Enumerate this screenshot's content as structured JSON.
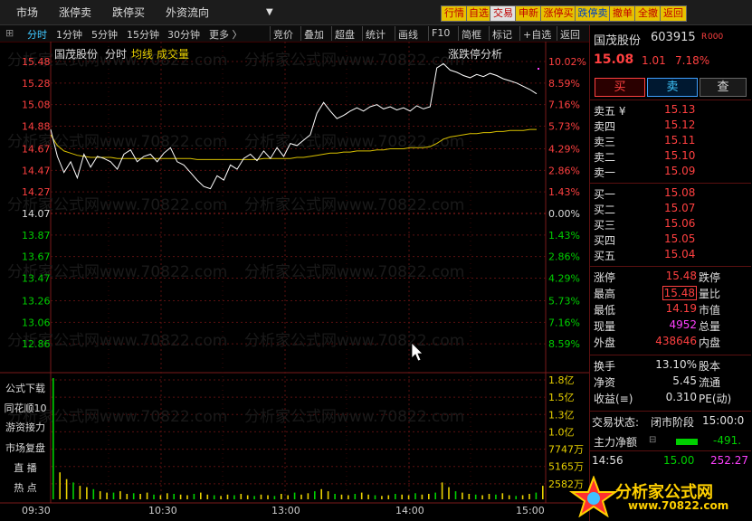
{
  "menubar": {
    "items": [
      "市场",
      "涨停卖",
      "跌停买",
      "外资流向"
    ],
    "buttons": [
      {
        "label": "行情",
        "color": "#e6c200",
        "text": "#c00000"
      },
      {
        "label": "自选",
        "color": "#e6c200",
        "text": "#c00000"
      },
      {
        "label": "交易",
        "color": "#e0e0e0",
        "text": "#c00000"
      },
      {
        "label": "申新",
        "color": "#e6c200",
        "text": "#c00000"
      },
      {
        "label": "涨停买",
        "color": "#e6c200",
        "text": "#c00000"
      },
      {
        "label": "跌停卖",
        "color": "#e6c200",
        "text": "#0040c0"
      },
      {
        "label": "撤单",
        "color": "#e6c200",
        "text": "#c00000"
      },
      {
        "label": "全撤",
        "color": "#e6c200",
        "text": "#c00000"
      },
      {
        "label": "返回",
        "color": "#e6c200",
        "text": "#c00000"
      }
    ]
  },
  "toolbar": {
    "tabs": [
      "分时",
      "1分钟",
      "5分钟",
      "15分钟",
      "30分钟",
      "更多 〉"
    ],
    "tools": [
      "竞价",
      "叠加",
      "超盘",
      "统计",
      "画线",
      "F10",
      "简框",
      "标记",
      "+自选",
      "返回"
    ]
  },
  "chart_header": {
    "stock_name": "国茂股份",
    "period": "分时",
    "avg_label": "均线",
    "vol_label": "成交量",
    "right_label": "涨跌停分析"
  },
  "price_axis": [
    "15.48",
    "15.28",
    "15.08",
    "14.88",
    "14.67",
    "14.47",
    "14.27",
    "14.07",
    "13.87",
    "13.67",
    "13.47",
    "13.26",
    "13.06",
    "12.86"
  ],
  "pct_axis": [
    "10.02%",
    "8.59%",
    "7.16%",
    "5.73%",
    "4.29%",
    "2.86%",
    "1.43%",
    "0.00%",
    "1.43%",
    "2.86%",
    "4.29%",
    "5.73%",
    "7.16%",
    "8.59%"
  ],
  "volume_axis": [
    "1.8亿",
    "1.5亿",
    "1.3亿",
    "1.0亿",
    "7747万",
    "5165万",
    "2582万"
  ],
  "time_axis": [
    "09:30",
    "10:30",
    "13:00",
    "14:00",
    "15:00"
  ],
  "side_buttons": [
    "公式下载",
    "同花顺10",
    "游资接力",
    "市场复盘",
    "直 播",
    "热 点"
  ],
  "watermark": "分析家公式网www.70822.com",
  "chart_data": {
    "type": "line",
    "prev_close": 14.07,
    "ylim": [
      12.66,
      15.48
    ],
    "x_range": [
      "09:30",
      "15:00"
    ],
    "series": [
      {
        "name": "价格",
        "values": [
          14.85,
          14.6,
          14.45,
          14.55,
          14.4,
          14.62,
          14.5,
          14.6,
          14.58,
          14.55,
          14.48,
          14.62,
          14.66,
          14.55,
          14.6,
          14.62,
          14.55,
          14.63,
          14.68,
          14.55,
          14.52,
          14.45,
          14.38,
          14.32,
          14.3,
          14.42,
          14.38,
          14.52,
          14.48,
          14.58,
          14.62,
          14.56,
          14.65,
          14.58,
          14.68,
          14.6,
          14.72,
          14.7,
          14.75,
          14.8,
          15.0,
          15.1,
          15.02,
          14.95,
          14.98,
          15.02,
          15.05,
          15.02,
          15.06,
          15.08,
          15.04,
          15.06,
          15.03,
          15.05,
          15.02,
          15.07,
          15.04,
          15.06,
          15.42,
          15.46,
          15.4,
          15.38,
          15.35,
          15.33,
          15.36,
          15.34,
          15.37,
          15.35,
          15.32,
          15.3,
          15.28,
          15.25,
          15.22,
          15.18
        ]
      },
      {
        "name": "均线",
        "values": [
          14.8,
          14.7,
          14.65,
          14.63,
          14.61,
          14.6,
          14.59,
          14.59,
          14.59,
          14.59,
          14.58,
          14.58,
          14.58,
          14.58,
          14.58,
          14.58,
          14.58,
          14.58,
          14.58,
          14.58,
          14.58,
          14.58,
          14.57,
          14.57,
          14.57,
          14.57,
          14.57,
          14.57,
          14.57,
          14.57,
          14.57,
          14.57,
          14.58,
          14.58,
          14.58,
          14.58,
          14.58,
          14.59,
          14.59,
          14.6,
          14.61,
          14.62,
          14.63,
          14.63,
          14.64,
          14.64,
          14.65,
          14.65,
          14.65,
          14.66,
          14.66,
          14.67,
          14.67,
          14.67,
          14.68,
          14.68,
          14.68,
          14.69,
          14.72,
          14.76,
          14.78,
          14.79,
          14.8,
          14.81,
          14.81,
          14.82,
          14.82,
          14.83,
          14.83,
          14.84,
          14.84,
          14.84,
          14.85,
          14.85
        ]
      }
    ],
    "volume": [
      180,
      40,
      30,
      25,
      20,
      18,
      15,
      12,
      10,
      10,
      12,
      8,
      9,
      8,
      10,
      7,
      6,
      9,
      8,
      7,
      6,
      8,
      10,
      7,
      6,
      5,
      7,
      6,
      8,
      6,
      5,
      7,
      6,
      5,
      8,
      6,
      10,
      7,
      9,
      12,
      15,
      12,
      8,
      7,
      6,
      8,
      10,
      7,
      6,
      5,
      6,
      8,
      7,
      6,
      9,
      7,
      8,
      10,
      25,
      18,
      12,
      10,
      8,
      7,
      6,
      8,
      7,
      9,
      6,
      5,
      6,
      8,
      10,
      20
    ]
  },
  "right_panel": {
    "stock_name": "国茂股份",
    "stock_code": "603915",
    "tag": "R",
    "tag2": "000",
    "price": "15.08",
    "change": "1.01",
    "change_pct": "7.18%",
    "buttons": {
      "buy": "买",
      "sell": "卖",
      "query": "查"
    },
    "asks": [
      {
        "label": "卖五 ¥",
        "price": "15.13"
      },
      {
        "label": "卖四",
        "price": "15.12"
      },
      {
        "label": "卖三",
        "price": "15.11"
      },
      {
        "label": "卖二",
        "price": "15.10"
      },
      {
        "label": "卖一",
        "price": "15.09"
      }
    ],
    "bids": [
      {
        "label": "买一",
        "price": "15.08"
      },
      {
        "label": "买二",
        "price": "15.07"
      },
      {
        "label": "买三",
        "price": "15.06"
      },
      {
        "label": "买四",
        "price": "15.05"
      },
      {
        "label": "买五",
        "price": "15.04"
      }
    ],
    "stats": [
      {
        "l1": "涨停",
        "v1": "15.48",
        "l2": "跌停",
        "c1": "red"
      },
      {
        "l1": "最高",
        "v1": "15.48",
        "l2": "量比",
        "c1": "red"
      },
      {
        "l1": "最低",
        "v1": "14.19",
        "l2": "市值",
        "c1": "red"
      },
      {
        "l1": "现量",
        "v1": "4952",
        "l2": "总量",
        "c1": "magenta"
      },
      {
        "l1": "外盘",
        "v1": "438646",
        "l2": "内盘",
        "c1": "red"
      }
    ],
    "stats2": [
      {
        "l1": "换手",
        "v1": "13.10%",
        "l2": "股本",
        "c1": "white"
      },
      {
        "l1": "净资",
        "v1": "5.45",
        "l2": "流通",
        "c1": "white"
      },
      {
        "l1": "收益(≡)",
        "v1": "0.310",
        "l2": "PE(动)",
        "c1": "white"
      }
    ],
    "trade_status_label": "交易状态:",
    "trade_status_value": "闭市阶段",
    "trade_time": "15:00:0",
    "netflow_label": "主力净额",
    "netflow_value": "-491.",
    "tick": {
      "time": "14:56",
      "price": "15.00",
      "amount": "252.27"
    },
    "logo_text": "分析家公式网",
    "logo_url": "www.70822.com"
  }
}
